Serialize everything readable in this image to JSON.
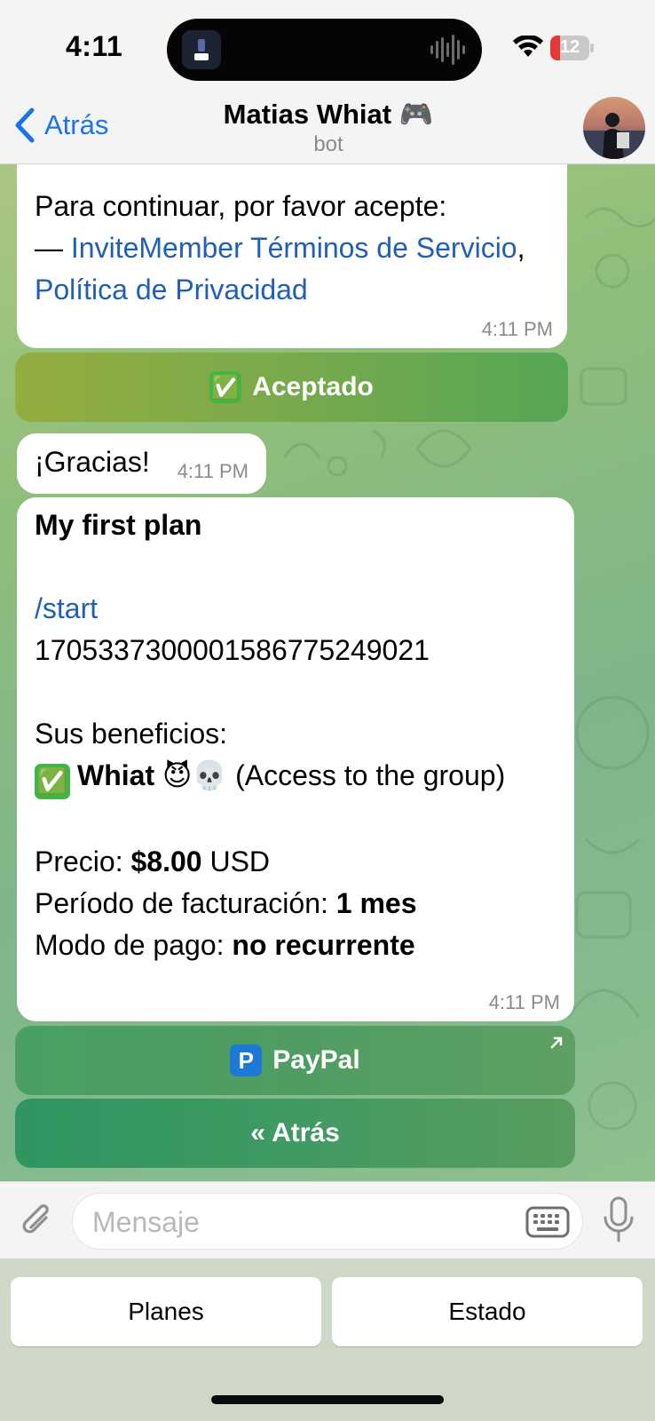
{
  "status_bar": {
    "time": "4:11",
    "battery_level": "12",
    "battery_fraction": 0.12,
    "battery_color": "#e53935",
    "icons": [
      "wifi-icon",
      "battery-icon",
      "island-app-icon",
      "sound-wave-icon"
    ]
  },
  "nav": {
    "back_label": "Atrás",
    "title": "Matias Whiat",
    "title_emoji": "🎮",
    "subtitle": "bot",
    "accent": "#1a73e8"
  },
  "messages": {
    "terms": {
      "line1": "Para continuar, por favor acepte:",
      "dash": "— ",
      "link1": "InviteMember Términos de Servicio",
      "sep": ", ",
      "link2": "Política de Privacidad",
      "time": "4:11 PM"
    },
    "accepted_button": {
      "icon": "✅",
      "label": "Aceptado"
    },
    "thanks": {
      "text": "¡Gracias!",
      "time": "4:11 PM"
    },
    "plan": {
      "title": "My first plan",
      "command": "/start",
      "code": "17053373000015867752490​21",
      "benefits_label": "Sus beneficios:",
      "benefit_check": "✅",
      "benefit_name": "Whiat",
      "benefit_emojis": "😈💀",
      "benefit_desc": "(Access to the group)",
      "price_label": "Precio: ",
      "price_value": "$8.00",
      "price_currency": " USD",
      "period_label": "Período de facturación: ",
      "period_value": "1 mes",
      "mode_label": "Modo de pago: ",
      "mode_value": "no recurrente",
      "time": "4:11 PM"
    },
    "paypal_button": {
      "icon": "P",
      "label": "PayPal"
    },
    "back_button": {
      "label": "« Atrás"
    }
  },
  "composer": {
    "placeholder": "Mensaje"
  },
  "reply_keyboard": {
    "left": "Planes",
    "right": "Estado"
  }
}
